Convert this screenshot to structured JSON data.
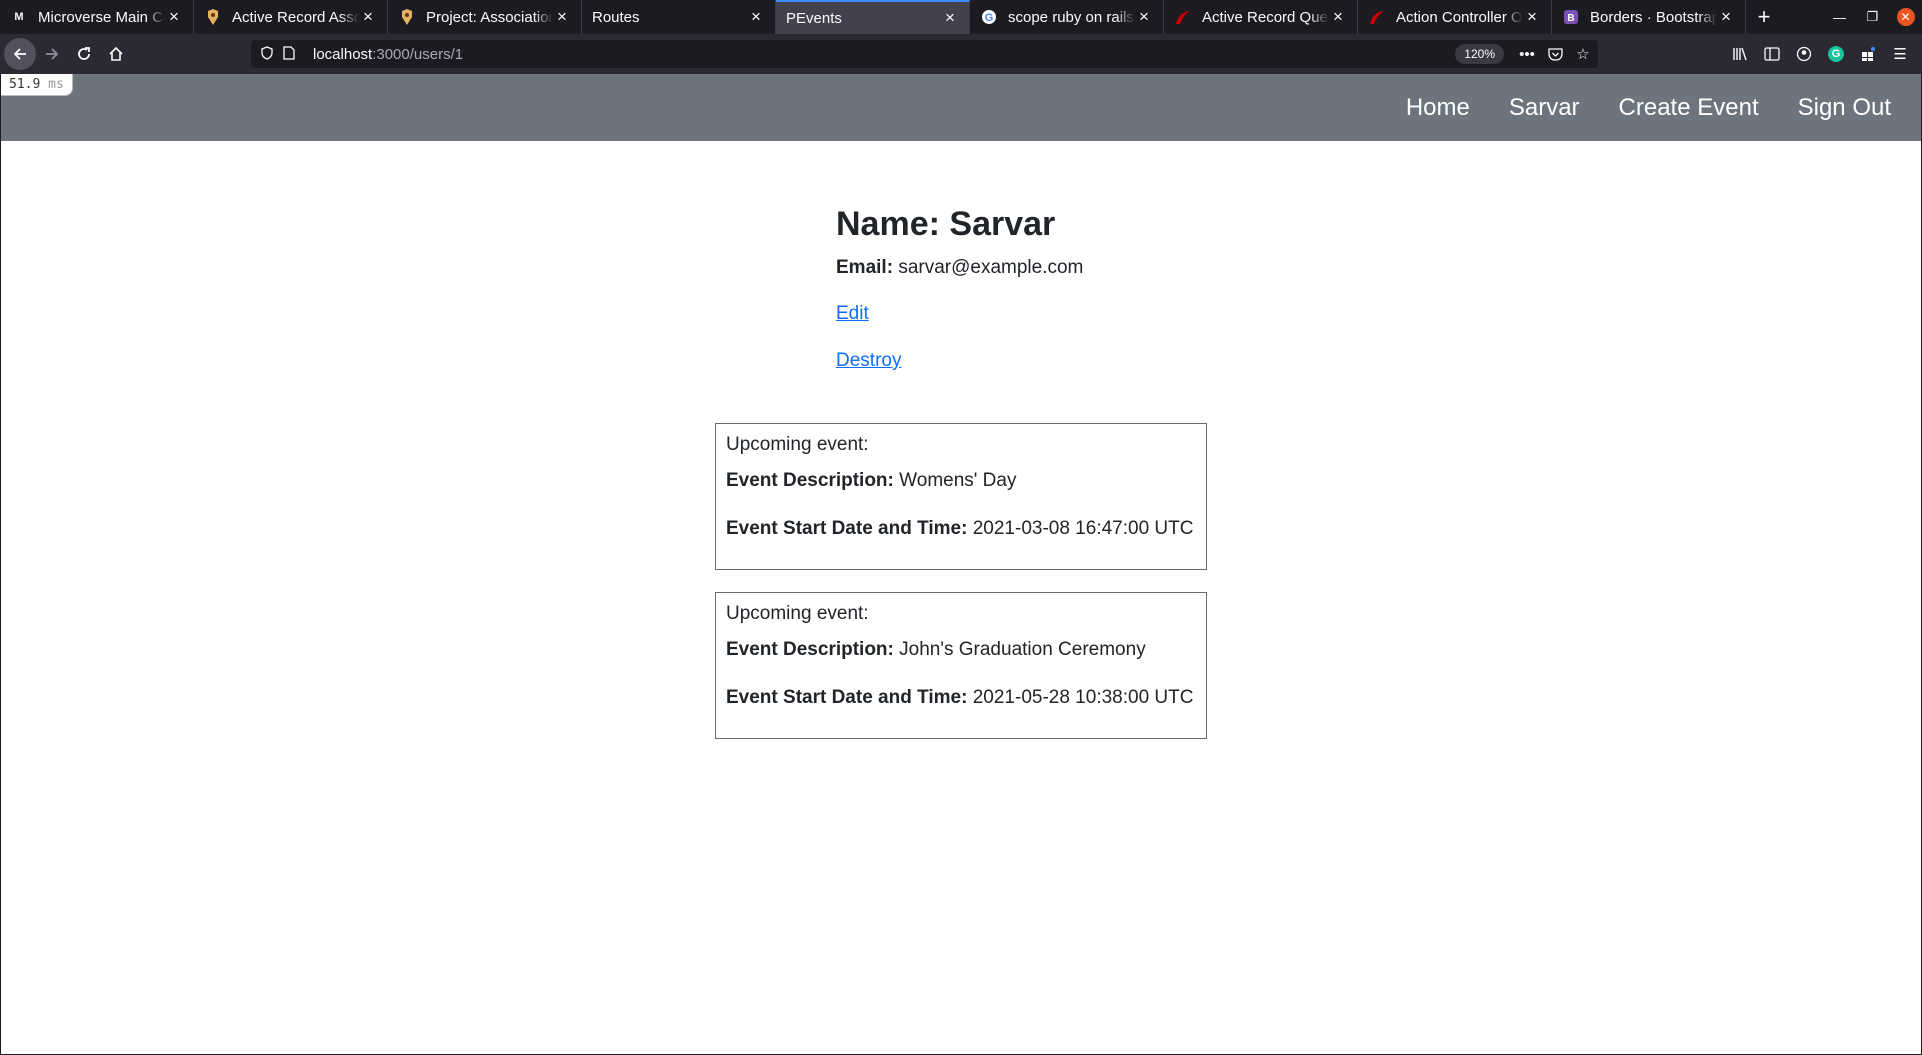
{
  "browser": {
    "tabs": [
      {
        "title": "Microverse Main Cu",
        "icon": "microverse-icon",
        "active": false
      },
      {
        "title": "Active Record Assoc",
        "icon": "odin-icon",
        "active": false
      },
      {
        "title": "Project: Association",
        "icon": "odin-icon",
        "active": false
      },
      {
        "title": "Routes",
        "icon": "",
        "active": false
      },
      {
        "title": "PEvents",
        "icon": "",
        "active": true
      },
      {
        "title": "scope ruby on rails g",
        "icon": "google-icon",
        "active": false
      },
      {
        "title": "Active Record Query",
        "icon": "rails-icon",
        "active": false
      },
      {
        "title": "Action Controller O",
        "icon": "rails-icon",
        "active": false
      },
      {
        "title": "Borders · Bootstrap",
        "icon": "bootstrap-icon",
        "active": false
      }
    ],
    "url_host": "localhost",
    "url_path": ":3000/users/1",
    "zoom": "120%"
  },
  "perf": {
    "value": "51.9",
    "unit": "ms"
  },
  "site_nav": {
    "home": "Home",
    "user": "Sarvar",
    "create": "Create Event",
    "signout": "Sign Out"
  },
  "user": {
    "name_label": "Name:",
    "name": "Sarvar",
    "email_label": "Email:",
    "email": "sarvar@example.com",
    "edit": "Edit",
    "destroy": "Destroy"
  },
  "events": [
    {
      "heading": "Upcoming event:",
      "desc_label": "Event Description:",
      "description": "Womens' Day",
      "date_label": "Event Start Date and Time:",
      "start": "2021-03-08 16:47:00 UTC"
    },
    {
      "heading": "Upcoming event:",
      "desc_label": "Event Description:",
      "description": "John's Graduation Ceremony",
      "date_label": "Event Start Date and Time:",
      "start": "2021-05-28 10:38:00 UTC"
    }
  ],
  "colors": {
    "nav_bg": "#6c757d",
    "link": "#0d6efd"
  }
}
